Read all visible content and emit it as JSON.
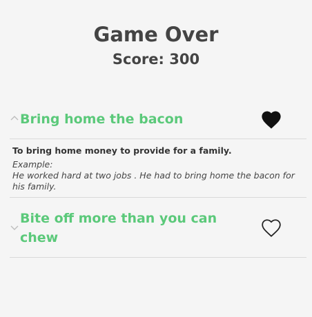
{
  "header": {
    "title": "Game Over",
    "score": "Score: 300"
  },
  "items": [
    {
      "phrase": "Bring home the bacon",
      "expanded": true,
      "favorited": true,
      "meaning": "To bring home money to provide for a family.",
      "example_label": "Example:",
      "example": "He worked hard at two jobs . He had to bring home the bacon for his family."
    },
    {
      "phrase": "Bite off more than you can chew",
      "expanded": false,
      "favorited": false
    }
  ],
  "colors": {
    "accent": "#5bc97a",
    "text": "#444444",
    "divider": "#d9d9d9",
    "background": "#f5f5f5"
  },
  "icons": {
    "expanded": "chevron-up-icon",
    "collapsed": "chevron-down-icon",
    "favorite_on": "heart-filled-icon",
    "favorite_off": "heart-outline-icon"
  }
}
